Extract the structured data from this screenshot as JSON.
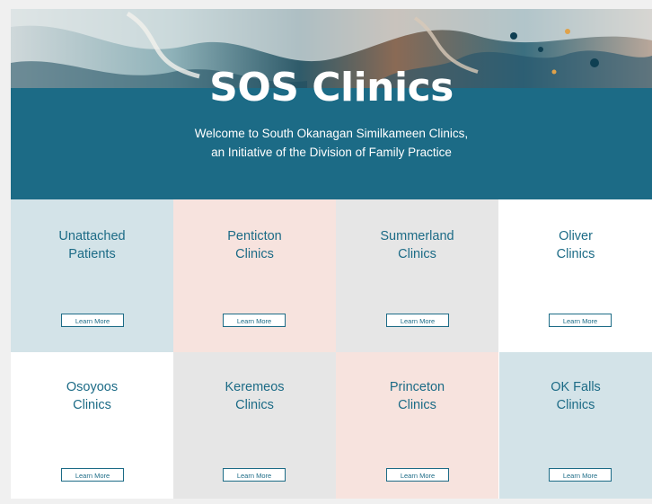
{
  "hero": {
    "title": "SOS Clinics",
    "subtitle_line1": "Welcome to South Okanagan Similkameen Clinics,",
    "subtitle_line2": "an Initiative of the Division of Family Practice"
  },
  "colors": {
    "brand": "#1c6b86",
    "tile_blue": "#d3e3e8",
    "tile_pink": "#f7e3de",
    "tile_gray": "#e6e6e6",
    "tile_white": "#ffffff"
  },
  "tiles": [
    {
      "line1": "Unattached",
      "line2": "Patients",
      "button": "Learn More",
      "tone": "tile_blue"
    },
    {
      "line1": "Penticton",
      "line2": "Clinics",
      "button": "Learn More",
      "tone": "tile_pink"
    },
    {
      "line1": "Summerland",
      "line2": "Clinics",
      "button": "Learn More",
      "tone": "tile_gray"
    },
    {
      "line1": "Oliver",
      "line2": "Clinics",
      "button": "Learn More",
      "tone": "tile_white"
    },
    {
      "line1": "Osoyoos",
      "line2": "Clinics",
      "button": "Learn More",
      "tone": "tile_white"
    },
    {
      "line1": "Keremeos",
      "line2": "Clinics",
      "button": "Learn More",
      "tone": "tile_gray"
    },
    {
      "line1": "Princeton",
      "line2": "Clinics",
      "button": "Learn More",
      "tone": "tile_pink"
    },
    {
      "line1": "OK Falls",
      "line2": "Clinics",
      "button": "Learn More",
      "tone": "tile_blue"
    }
  ]
}
